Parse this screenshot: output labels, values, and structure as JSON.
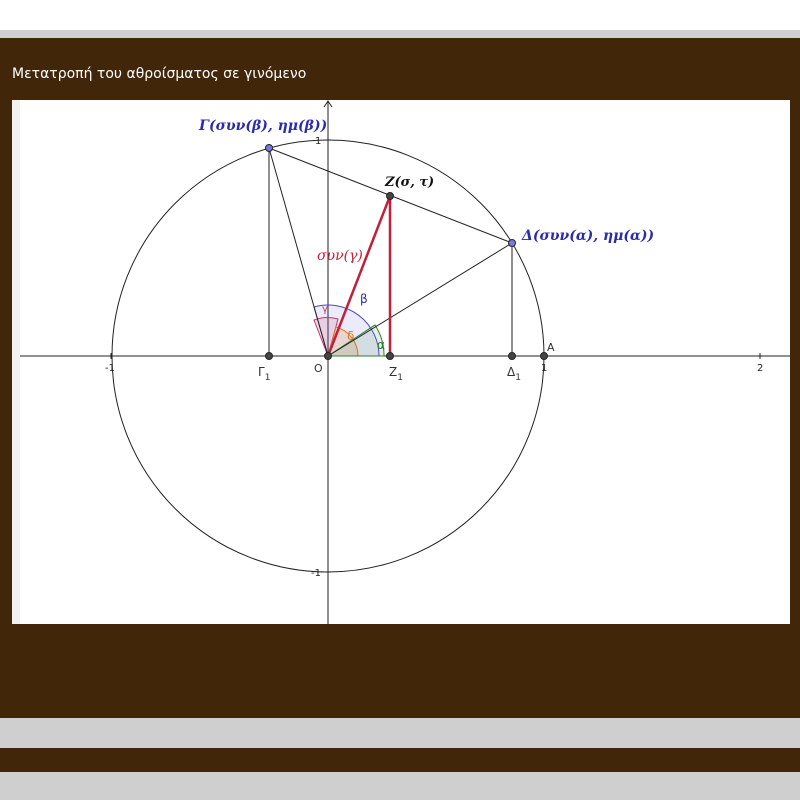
{
  "header": {
    "title": "Μετατροπή του αθροίσματος σε γινόμενο"
  },
  "colors": {
    "blue": "#2b2bb0",
    "red": "#c0203a",
    "orange": "#e07820",
    "green": "#2e7d32",
    "pink": "#cc3366"
  },
  "graph": {
    "ticks": {
      "x_neg1": "-1",
      "x_1": "1",
      "x_2": "2",
      "y_1": "1",
      "y_neg1": "-1",
      "origin": "0"
    },
    "labels": {
      "gamma": "Γ(συν(β), ημ(β))",
      "delta": "Δ(συν(α), ημ(α))",
      "z": "Z(σ, τ)",
      "cos_gamma": "συν(γ)",
      "A": "A",
      "O": "O",
      "gamma1": "Γ",
      "z1": "Z",
      "delta1": "Δ",
      "sub1": "1",
      "angle_beta": "β",
      "angle_alpha": "α",
      "angle_delta": "δ",
      "angle_gamma": "γ"
    }
  }
}
